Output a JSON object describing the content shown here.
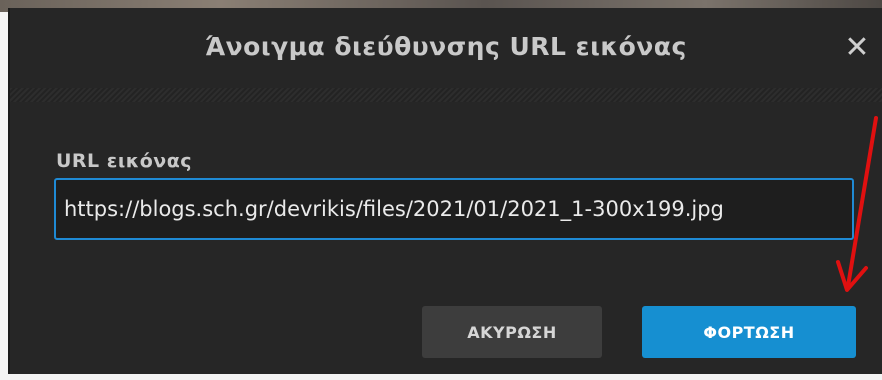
{
  "dialog": {
    "title": "Άνοιγμα διεύθυνσης URL εικόνας",
    "close_label": "✕"
  },
  "form": {
    "url_label": "URL εικόνας",
    "url_value": "https://blogs.sch.gr/devrikis/files/2021/01/2021_1-300x199.jpg"
  },
  "buttons": {
    "cancel_label": "ΑΚΥΡΩΣΗ",
    "load_label": "ΦΟΡΤΩΣΗ"
  },
  "colors": {
    "dialog_bg": "#262626",
    "accent": "#168fd1",
    "annotation_arrow": "#e01010"
  },
  "icons": {
    "close": "close-icon",
    "annotation": "red-arrow-annotation"
  }
}
